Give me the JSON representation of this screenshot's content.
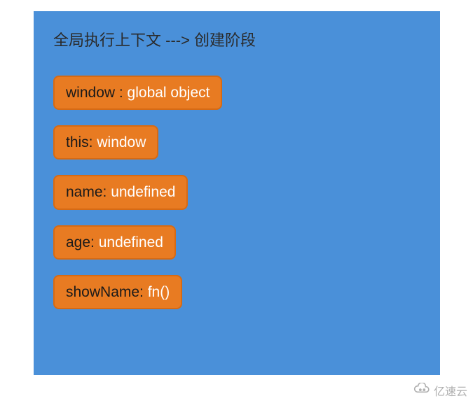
{
  "title": "全局执行上下文 ---> 创建阶段",
  "items": [
    {
      "key": "window : ",
      "value": "global object"
    },
    {
      "key": "this: ",
      "value": "window"
    },
    {
      "key": "name: ",
      "value": "undefined"
    },
    {
      "key": "age: ",
      "value": "undefined"
    },
    {
      "key": "showName: ",
      "value": "fn()"
    }
  ],
  "watermark": "亿速云",
  "colors": {
    "panel_bg": "#4a90d9",
    "pill_bg": "#e87b22",
    "pill_border": "#d66a14",
    "key_text": "#1a1a1a",
    "value_text": "#ffffff"
  }
}
